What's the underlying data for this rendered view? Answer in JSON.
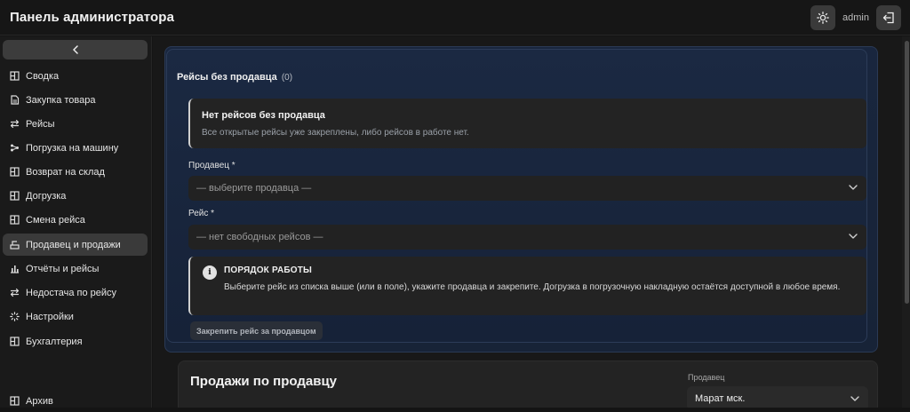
{
  "header": {
    "title": "Панель администратора",
    "user": "admin",
    "theme_icon": "sun-icon",
    "logout_icon": "logout-icon"
  },
  "sidebar": {
    "items": [
      {
        "label": "Сводка",
        "icon": "grid-icon"
      },
      {
        "label": "Закупка товара",
        "icon": "document-icon"
      },
      {
        "label": "Рейсы",
        "icon": "swap-icon"
      },
      {
        "label": "Погрузка на машину",
        "icon": "share-nodes-icon"
      },
      {
        "label": "Возврат на склад",
        "icon": "grid-icon"
      },
      {
        "label": "Догрузка",
        "icon": "grid-icon"
      },
      {
        "label": "Смена рейса",
        "icon": "grid-icon"
      },
      {
        "label": "Продавец и продажи",
        "icon": "cashier-icon",
        "active": true
      },
      {
        "label": "Отчёты и рейсы",
        "icon": "bar-chart-icon"
      },
      {
        "label": "Недостача по рейсу",
        "icon": "swap-icon"
      },
      {
        "label": "Настройки",
        "icon": "loader-icon"
      },
      {
        "label": "Бухгалтерия",
        "icon": "grid-icon"
      },
      {
        "label": "Архив",
        "icon": "grid-icon"
      }
    ]
  },
  "unassigned": {
    "title": "Рейсы без продавца",
    "count": "(0)",
    "empty_title": "Нет рейсов без продавца",
    "empty_text": "Все открытые рейсы уже закреплены, либо рейсов в работе нет.",
    "seller_label": "Продавец *",
    "seller_placeholder": "— выберите продавца —",
    "trip_label": "Рейс *",
    "trip_placeholder": "— нет свободных рейсов —",
    "notice_title": "ПОРЯДОК РАБОТЫ",
    "notice_text": "Выберите рейс из списка выше (или в поле), укажите продавца и закрепите. Догрузка в погрузочную накладную остаётся доступной в любое время.",
    "assign_button": "Закрепить рейс за продавцом"
  },
  "sales": {
    "title": "Продажи по продавцу",
    "seller_label": "Продавец",
    "seller_value": "Марат мск."
  },
  "colors": {
    "panel_bg": "#1b2942",
    "active_nav": "#3a3a3a"
  }
}
